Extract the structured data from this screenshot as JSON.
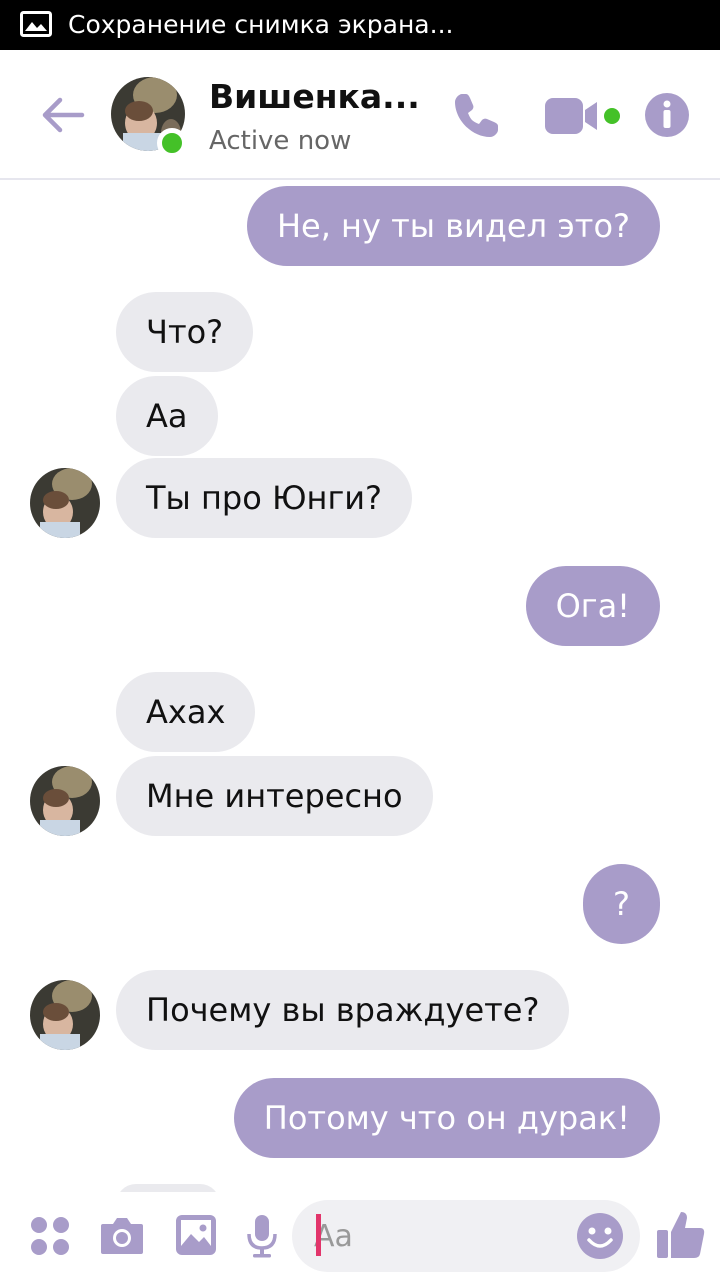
{
  "statusbar": {
    "notification_text": "Сохранение снимка экрана..."
  },
  "header": {
    "contact_name": "Вишенка...",
    "contact_status": "Active now"
  },
  "messages": [
    {
      "direction": "out",
      "text": "Не, ну ты видел это?"
    },
    {
      "direction": "in",
      "text": "Что?"
    },
    {
      "direction": "in",
      "text": "Аа"
    },
    {
      "direction": "in",
      "text": "Ты про Юнги?"
    },
    {
      "direction": "out",
      "text": "Ога!"
    },
    {
      "direction": "in",
      "text": "Ахах"
    },
    {
      "direction": "in",
      "text": "Мне интересно"
    },
    {
      "direction": "out",
      "text": "?"
    },
    {
      "direction": "in",
      "text": "Почему вы враждуете?"
    },
    {
      "direction": "out",
      "text": "Потому что он дурак!"
    }
  ],
  "composer": {
    "placeholder": "Aa"
  },
  "colors": {
    "accent": "#a89cc9",
    "incoming_bubble": "#eaeaee",
    "online": "#44c128",
    "caret": "#e2356b"
  },
  "icons": [
    "image-icon",
    "back-arrow-icon",
    "phone-icon",
    "video-camera-icon",
    "info-icon",
    "apps-grid-icon",
    "camera-icon",
    "gallery-icon",
    "microphone-icon",
    "emoji-icon",
    "thumbs-up-icon"
  ]
}
